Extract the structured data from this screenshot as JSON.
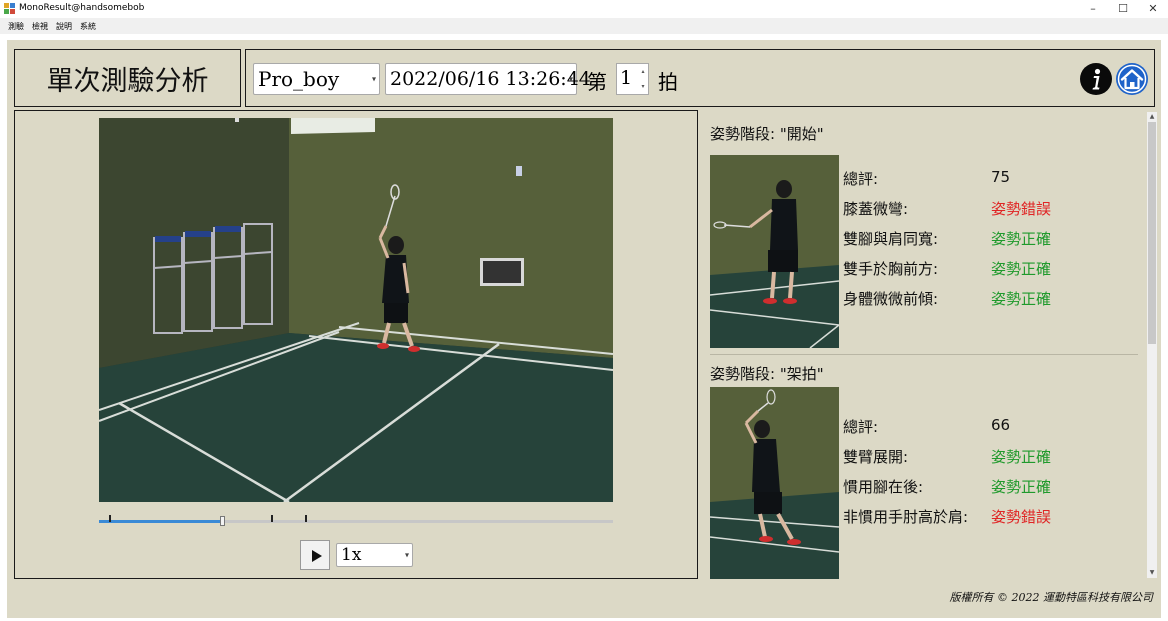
{
  "window": {
    "title": "MonoResult@handsomebob",
    "minimize": "–",
    "maximize": "☐",
    "close": "✕"
  },
  "menu": [
    "測驗",
    "檢視",
    "說明",
    "系統"
  ],
  "header": {
    "title": "單次測驗分析",
    "player": "Pro_boy",
    "datetime": "2022/06/16 13:26:44",
    "stroke_prefix": "第",
    "stroke_number": "1",
    "stroke_suffix": "拍",
    "info_icon": "info-icon",
    "home_icon": "home-icon"
  },
  "player": {
    "playback_position": 0.24,
    "markers": [
      0.02,
      0.335,
      0.4
    ],
    "play_icon": "play-icon",
    "speed": "1x"
  },
  "analysis": {
    "phases": [
      {
        "title": "姿勢階段: \"開始\"",
        "items": [
          {
            "label": "總評:",
            "value": "75",
            "status": "score"
          },
          {
            "label": "膝蓋微彎:",
            "value": "姿勢錯誤",
            "status": "error"
          },
          {
            "label": "雙腳與肩同寬:",
            "value": "姿勢正確",
            "status": "ok"
          },
          {
            "label": "雙手於胸前方:",
            "value": "姿勢正確",
            "status": "ok"
          },
          {
            "label": "身體微微前傾:",
            "value": "姿勢正確",
            "status": "ok"
          }
        ]
      },
      {
        "title": "姿勢階段: \"架拍\"",
        "items": [
          {
            "label": "總評:",
            "value": "66",
            "status": "score"
          },
          {
            "label": "雙臂展開:",
            "value": "姿勢正確",
            "status": "ok"
          },
          {
            "label": "慣用腳在後:",
            "value": "姿勢正確",
            "status": "ok"
          },
          {
            "label": "非慣用手肘高於肩:",
            "value": "姿勢錯誤",
            "status": "error"
          }
        ]
      }
    ]
  },
  "colors": {
    "ok": "#1f9a2c",
    "error": "#e02424",
    "background": "#dcd9c6",
    "accent": "#3a8ad6"
  },
  "footer": {
    "copyright": "版權所有 © 2022 運動特區科技有限公司"
  }
}
